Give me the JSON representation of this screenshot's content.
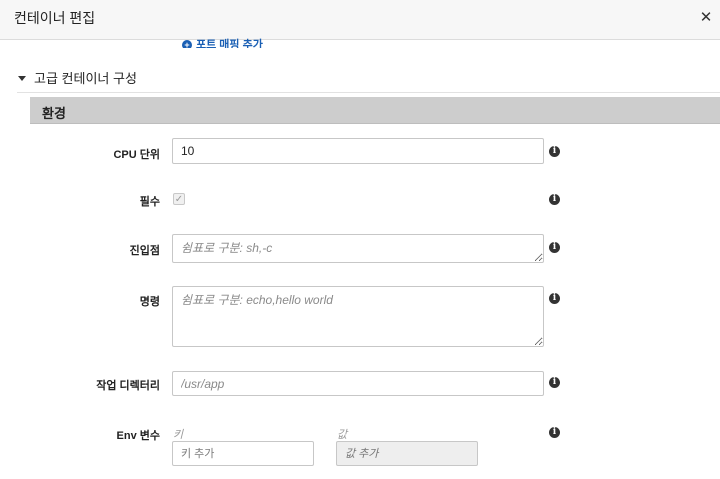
{
  "header": {
    "title": "컨테이너 편집",
    "close_glyph": "✕"
  },
  "port_link": {
    "icon": "plus-circle-icon",
    "label": "포트 매핑 추가"
  },
  "advanced": {
    "icon": "caret-down-icon",
    "title": "고급 컨테이너 구성"
  },
  "environment": {
    "section_title": "환경",
    "cpu": {
      "label": "CPU 단위",
      "value": "10"
    },
    "essential": {
      "label": "필수",
      "checked": true
    },
    "entrypoint": {
      "label": "진입점",
      "placeholder": "쉼표로 구분: sh,-c"
    },
    "command": {
      "label": "명령",
      "placeholder": "쉼표로 구분: echo,hello world"
    },
    "workdir": {
      "label": "작업 디렉터리",
      "placeholder": "/usr/app"
    },
    "env_vars": {
      "label": "Env 변수",
      "key_header": "키",
      "value_header": "값",
      "key_placeholder": "키 추가",
      "value_placeholder": "값 추가"
    }
  },
  "info_glyph": "i",
  "check_glyph": "✓"
}
